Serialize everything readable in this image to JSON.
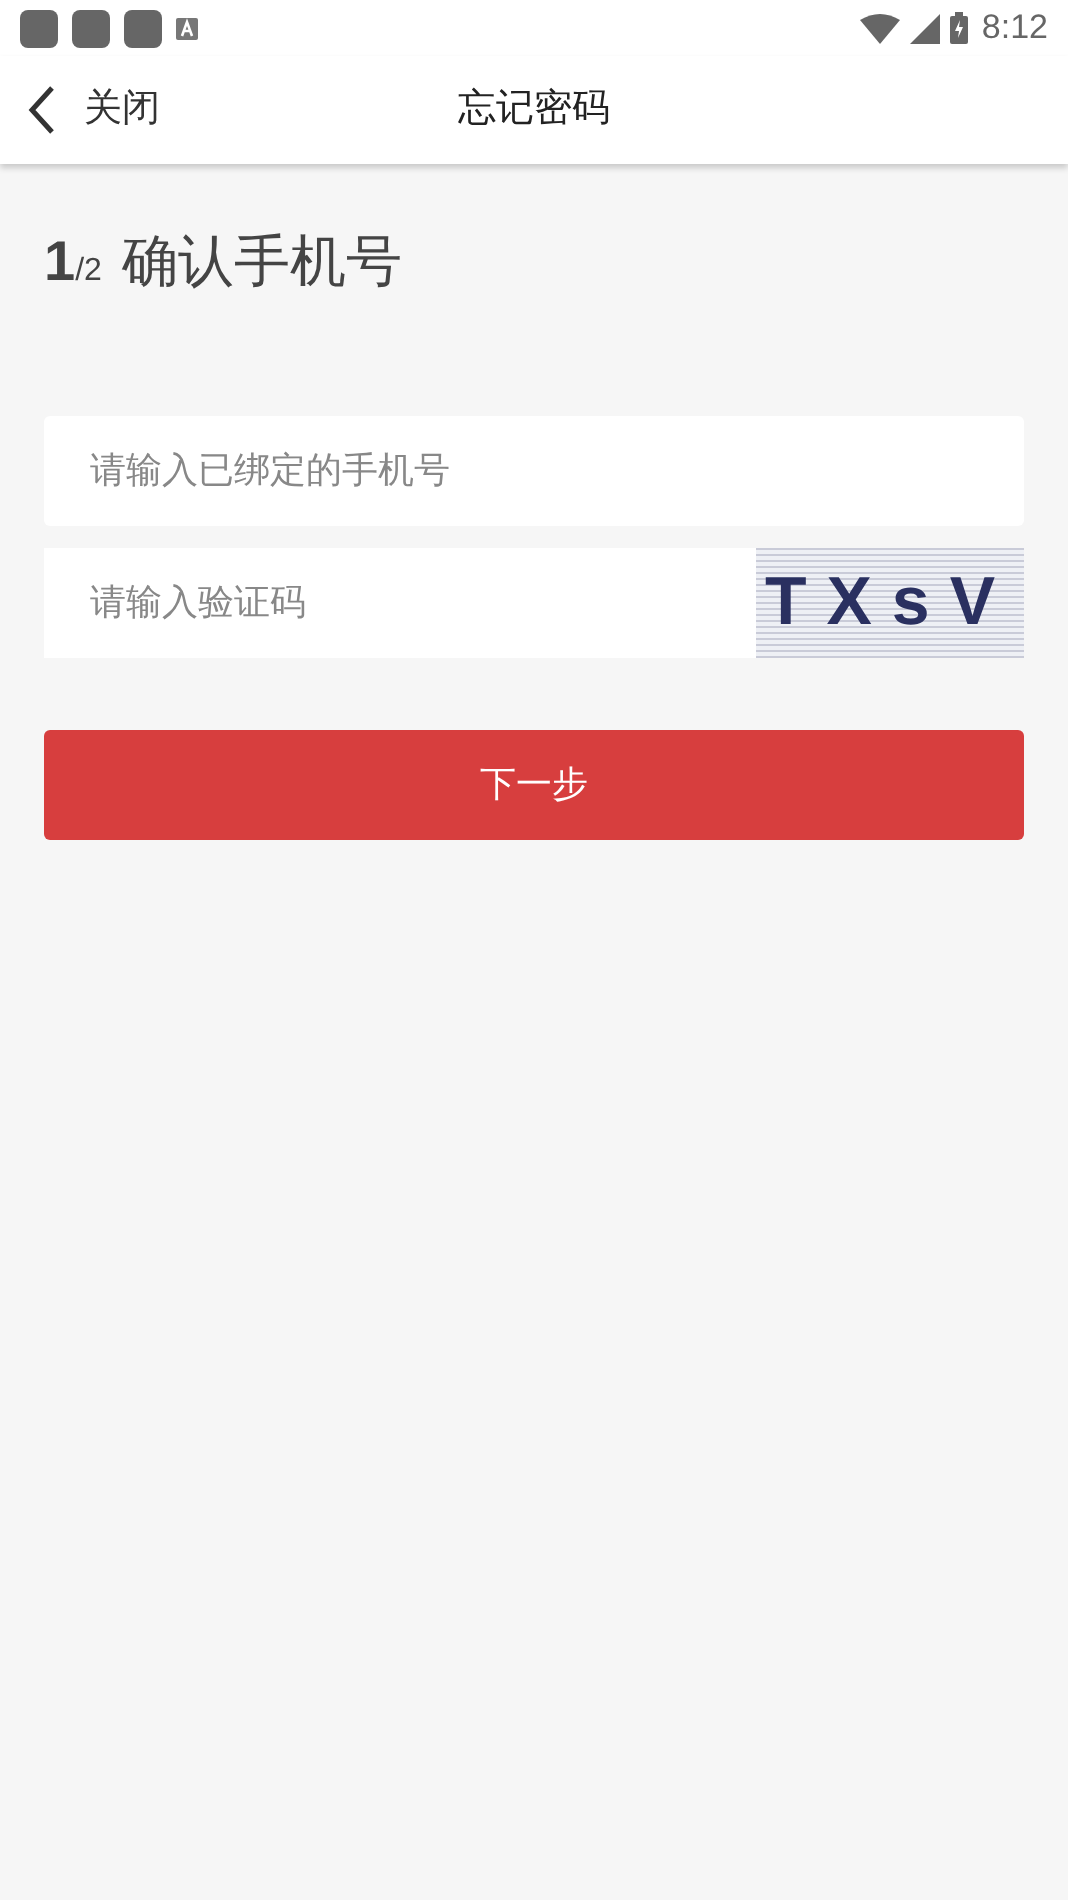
{
  "status_bar": {
    "time": "8:12"
  },
  "header": {
    "back_label": "关闭",
    "title": "忘记密码"
  },
  "step": {
    "current": "1",
    "total": "/2",
    "title": "确认手机号"
  },
  "phone_field": {
    "placeholder": "请输入已绑定的手机号"
  },
  "code_field": {
    "placeholder": "请输入验证码"
  },
  "captcha": {
    "text": "TXsV"
  },
  "next_button": {
    "label": "下一步"
  }
}
